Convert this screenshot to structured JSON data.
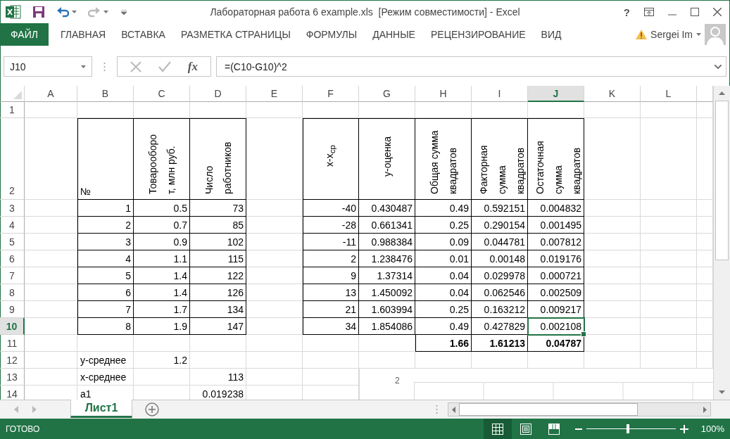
{
  "title_bar": {
    "title": "Лабораторная работа 6 example.xls  [Режим совместимости] - Excel",
    "help": "?",
    "quick_access": [
      {
        "kind": "save",
        "disabled": false
      },
      {
        "kind": "undo",
        "disabled": false
      },
      {
        "kind": "redo",
        "disabled": true
      }
    ]
  },
  "ribbon": {
    "file_tab": "ФАЙЛ",
    "tabs": [
      "ГЛАВНАЯ",
      "ВСТАВКА",
      "РАЗМЕТКА СТРАНИЦЫ",
      "ФОРМУЛЫ",
      "ДАННЫЕ",
      "РЕЦЕНЗИРОВАНИЕ",
      "ВИД"
    ],
    "user": "Sergei Im"
  },
  "formula_bar": {
    "name_box": "J10",
    "fx": "fx",
    "formula": "=(C10-G10)^2"
  },
  "sheet": {
    "columns": [
      {
        "label": "A",
        "selected": false
      },
      {
        "label": "B",
        "selected": false
      },
      {
        "label": "C",
        "selected": false
      },
      {
        "label": "D",
        "selected": false
      },
      {
        "label": "E",
        "selected": false
      },
      {
        "label": "F",
        "selected": false
      },
      {
        "label": "G",
        "selected": false
      },
      {
        "label": "H",
        "selected": false
      },
      {
        "label": "I",
        "selected": false
      },
      {
        "label": "J",
        "selected": true
      },
      {
        "label": "K",
        "selected": false
      },
      {
        "label": "L",
        "selected": false
      }
    ],
    "rows": [
      {
        "header": "1",
        "selected": false,
        "boxed": [
          false,
          false,
          false,
          false,
          false,
          false,
          false,
          false,
          false,
          false,
          false,
          false
        ],
        "cells": [
          null,
          null,
          null,
          null,
          null,
          null,
          null,
          null,
          null,
          null,
          null,
          null
        ]
      },
      {
        "header": "2",
        "selected": false,
        "bold": false,
        "boxed": [
          false,
          true,
          true,
          true,
          false,
          true,
          true,
          true,
          true,
          true,
          false,
          false
        ],
        "cells": [
          null,
          {
            "kind": "label",
            "text": "№"
          },
          {
            "kind": "vertical",
            "lines": [
              "Товарооборо",
              "т, млн руб."
            ]
          },
          {
            "kind": "vertical",
            "lines": [
              "Число",
              "работников"
            ]
          },
          null,
          {
            "kind": "centered",
            "lines": [
              "x-x$_{ср}$"
            ]
          },
          {
            "kind": "centered",
            "lines": [
              "y-оценка"
            ]
          },
          {
            "kind": "vertical",
            "lines": [
              "Общая сумма",
              "квадратов"
            ]
          },
          {
            "kind": "vertical",
            "lines": [
              "Факторная",
              "сумма",
              "квадратов"
            ]
          },
          {
            "kind": "vertical",
            "lines": [
              "Остаточная",
              "сумма",
              "квадратов"
            ]
          },
          null,
          null
        ]
      },
      {
        "header": "3",
        "selected": false,
        "bold": false,
        "boxed": [
          false,
          true,
          true,
          true,
          false,
          true,
          true,
          true,
          true,
          true,
          false,
          false
        ],
        "cells": [
          null,
          {
            "kind": "number",
            "text": "1"
          },
          {
            "kind": "number",
            "text": "0.5"
          },
          {
            "kind": "number",
            "text": "73"
          },
          null,
          {
            "kind": "number",
            "text": "-40"
          },
          {
            "kind": "number",
            "text": "0.430487"
          },
          {
            "kind": "number",
            "text": "0.49"
          },
          {
            "kind": "number",
            "text": "0.592151"
          },
          {
            "kind": "number",
            "text": "0.004832"
          },
          null,
          null
        ]
      },
      {
        "header": "4",
        "selected": false,
        "bold": false,
        "boxed": [
          false,
          true,
          true,
          true,
          false,
          true,
          true,
          true,
          true,
          true,
          false,
          false
        ],
        "cells": [
          null,
          {
            "kind": "number",
            "text": "2"
          },
          {
            "kind": "number",
            "text": "0.7"
          },
          {
            "kind": "number",
            "text": "85"
          },
          null,
          {
            "kind": "number",
            "text": "-28"
          },
          {
            "kind": "number",
            "text": "0.661341"
          },
          {
            "kind": "number",
            "text": "0.25"
          },
          {
            "kind": "number",
            "text": "0.290154"
          },
          {
            "kind": "number",
            "text": "0.001495"
          },
          null,
          null
        ]
      },
      {
        "header": "5",
        "selected": false,
        "bold": false,
        "boxed": [
          false,
          true,
          true,
          true,
          false,
          true,
          true,
          true,
          true,
          true,
          false,
          false
        ],
        "cells": [
          null,
          {
            "kind": "number",
            "text": "3"
          },
          {
            "kind": "number",
            "text": "0.9"
          },
          {
            "kind": "number",
            "text": "102"
          },
          null,
          {
            "kind": "number",
            "text": "-11"
          },
          {
            "kind": "number",
            "text": "0.988384"
          },
          {
            "kind": "number",
            "text": "0.09"
          },
          {
            "kind": "number",
            "text": "0.044781"
          },
          {
            "kind": "number",
            "text": "0.007812"
          },
          null,
          null
        ]
      },
      {
        "header": "6",
        "selected": false,
        "bold": false,
        "boxed": [
          false,
          true,
          true,
          true,
          false,
          true,
          true,
          true,
          true,
          true,
          false,
          false
        ],
        "cells": [
          null,
          {
            "kind": "number",
            "text": "4"
          },
          {
            "kind": "number",
            "text": "1.1"
          },
          {
            "kind": "number",
            "text": "115"
          },
          null,
          {
            "kind": "number",
            "text": "2"
          },
          {
            "kind": "number",
            "text": "1.238476"
          },
          {
            "kind": "number",
            "text": "0.01"
          },
          {
            "kind": "number",
            "text": "0.00148"
          },
          {
            "kind": "number",
            "text": "0.019176"
          },
          null,
          null
        ]
      },
      {
        "header": "7",
        "selected": false,
        "bold": false,
        "boxed": [
          false,
          true,
          true,
          true,
          false,
          true,
          true,
          true,
          true,
          true,
          false,
          false
        ],
        "cells": [
          null,
          {
            "kind": "number",
            "text": "5"
          },
          {
            "kind": "number",
            "text": "1.4"
          },
          {
            "kind": "number",
            "text": "122"
          },
          null,
          {
            "kind": "number",
            "text": "9"
          },
          {
            "kind": "number",
            "text": "1.37314"
          },
          {
            "kind": "number",
            "text": "0.04"
          },
          {
            "kind": "number",
            "text": "0.029978"
          },
          {
            "kind": "number",
            "text": "0.000721"
          },
          null,
          null
        ]
      },
      {
        "header": "8",
        "selected": false,
        "bold": false,
        "boxed": [
          false,
          true,
          true,
          true,
          false,
          true,
          true,
          true,
          true,
          true,
          false,
          false
        ],
        "cells": [
          null,
          {
            "kind": "number",
            "text": "6"
          },
          {
            "kind": "number",
            "text": "1.4"
          },
          {
            "kind": "number",
            "text": "126"
          },
          null,
          {
            "kind": "number",
            "text": "13"
          },
          {
            "kind": "number",
            "text": "1.450092"
          },
          {
            "kind": "number",
            "text": "0.04"
          },
          {
            "kind": "number",
            "text": "0.062546"
          },
          {
            "kind": "number",
            "text": "0.002509"
          },
          null,
          null
        ]
      },
      {
        "header": "9",
        "selected": false,
        "bold": false,
        "boxed": [
          false,
          true,
          true,
          true,
          false,
          true,
          true,
          true,
          true,
          true,
          false,
          false
        ],
        "cells": [
          null,
          {
            "kind": "number",
            "text": "7"
          },
          {
            "kind": "number",
            "text": "1.7"
          },
          {
            "kind": "number",
            "text": "134"
          },
          null,
          {
            "kind": "number",
            "text": "21"
          },
          {
            "kind": "number",
            "text": "1.603994"
          },
          {
            "kind": "number",
            "text": "0.25"
          },
          {
            "kind": "number",
            "text": "0.163212"
          },
          {
            "kind": "number",
            "text": "0.009217"
          },
          null,
          null
        ]
      },
      {
        "header": "10",
        "selected": true,
        "bold": false,
        "boxed": [
          false,
          true,
          true,
          true,
          false,
          true,
          true,
          true,
          true,
          true,
          false,
          false
        ],
        "cells": [
          null,
          {
            "kind": "number",
            "text": "8"
          },
          {
            "kind": "number",
            "text": "1.9"
          },
          {
            "kind": "number",
            "text": "147"
          },
          null,
          {
            "kind": "number",
            "text": "34"
          },
          {
            "kind": "number",
            "text": "1.854086"
          },
          {
            "kind": "number",
            "text": "0.49"
          },
          {
            "kind": "number",
            "text": "0.427829"
          },
          {
            "kind": "number",
            "text": "0.002108"
          },
          null,
          null
        ]
      },
      {
        "header": "11",
        "selected": false,
        "bold": true,
        "boxed": [
          false,
          false,
          false,
          false,
          false,
          false,
          false,
          true,
          true,
          true,
          false,
          false
        ],
        "cells": [
          null,
          null,
          null,
          null,
          null,
          null,
          null,
          {
            "kind": "number",
            "text": "1.66"
          },
          {
            "kind": "number",
            "text": "1.61213"
          },
          {
            "kind": "number",
            "text": "0.04787"
          },
          null,
          null
        ]
      },
      {
        "header": "12",
        "selected": false,
        "bold": false,
        "boxed": [
          false,
          false,
          false,
          false,
          false,
          false,
          false,
          false,
          false,
          false,
          false,
          false
        ],
        "cells": [
          null,
          {
            "kind": "label",
            "text": "y-среднее"
          },
          {
            "kind": "number",
            "text": "1.2"
          },
          null,
          null,
          null,
          null,
          null,
          null,
          null,
          null,
          null
        ]
      },
      {
        "header": "13",
        "selected": false,
        "bold": false,
        "cells": [
          null,
          {
            "kind": "label",
            "text": "x-среднее"
          },
          null,
          {
            "kind": "number",
            "text": "113"
          },
          null,
          null,
          null,
          null,
          null,
          null,
          null,
          null
        ]
      },
      {
        "header": "14",
        "selected": false,
        "bold": false,
        "cells": [
          null,
          {
            "kind": "label",
            "text": "a1"
          },
          null,
          {
            "kind": "number",
            "text": "0.019238"
          },
          null,
          null,
          null,
          null,
          null,
          null,
          null,
          null
        ]
      }
    ],
    "chart": {
      "tick_label": "2"
    }
  },
  "sheet_tabs": [
    {
      "label": "Лист1",
      "selected": true
    }
  ],
  "status_bar": {
    "status": "ГОТОВО",
    "views": [
      {
        "kind": "normal",
        "selected": true
      },
      {
        "kind": "page_layout",
        "selected": false
      },
      {
        "kind": "page_break",
        "selected": false
      }
    ],
    "zoom": {
      "level": 0.47,
      "reading": "100%"
    }
  }
}
